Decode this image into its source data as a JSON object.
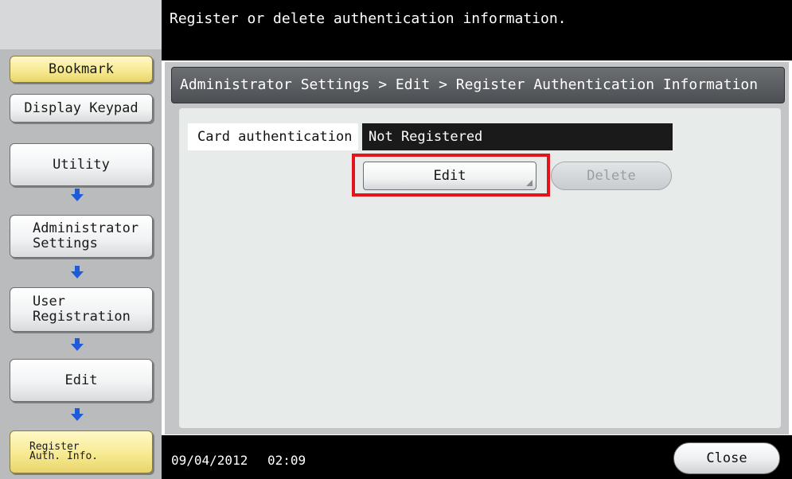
{
  "header": {
    "message": "Register or delete authentication information."
  },
  "sidebar": {
    "bookmark": "Bookmark",
    "display_keypad": "Display Keypad",
    "steps": [
      {
        "label": "Utility"
      },
      {
        "label": "Administrator\nSettings"
      },
      {
        "label": "User\nRegistration"
      },
      {
        "label": "Edit"
      },
      {
        "label": "Register\nAuth. Info."
      }
    ]
  },
  "breadcrumb": "Administrator Settings > Edit > Register Authentication Information",
  "card_auth": {
    "label": "Card authentication",
    "value": "Not Registered"
  },
  "actions": {
    "edit": "Edit",
    "delete": "Delete"
  },
  "footer": {
    "date": "09/04/2012",
    "time": "02:09",
    "close": "Close"
  },
  "colors": {
    "highlight": "#e4141b",
    "yellow_button": "#f7ea92",
    "bar": "#000000"
  },
  "icons": {
    "flow_arrow": "arrow-down-icon"
  }
}
